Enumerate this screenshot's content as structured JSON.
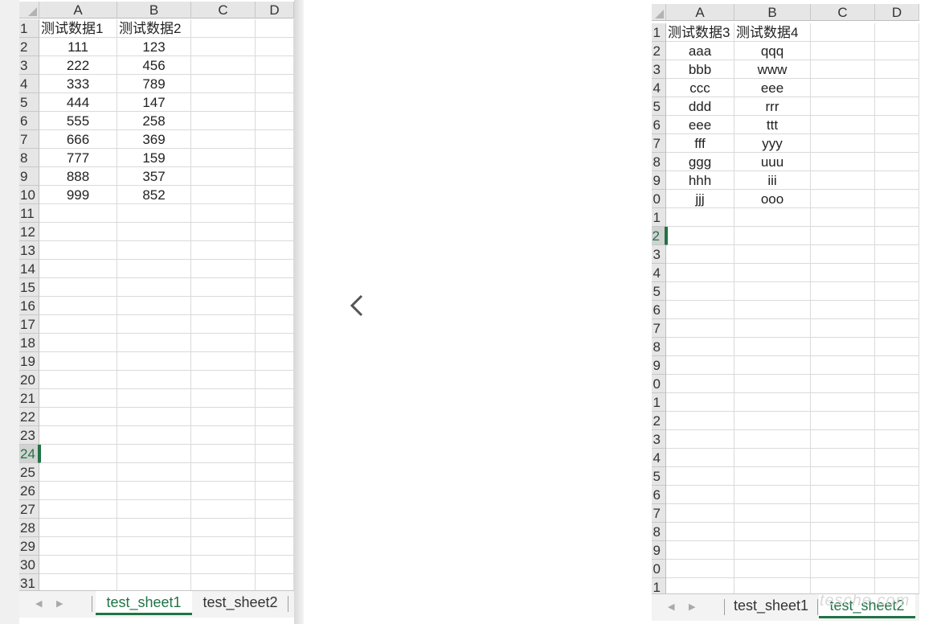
{
  "left": {
    "columns": [
      "A",
      "B",
      "C",
      "D"
    ],
    "row_numbers": [
      "1",
      "2",
      "3",
      "4",
      "5",
      "6",
      "7",
      "8",
      "9",
      "10",
      "11",
      "12",
      "13",
      "14",
      "15",
      "16",
      "17",
      "18",
      "19",
      "20",
      "21",
      "22",
      "23",
      "24",
      "25",
      "26",
      "27",
      "28",
      "29",
      "30",
      "31"
    ],
    "active_row": "24",
    "rows": [
      [
        "测试数据1",
        "测试数据2"
      ],
      [
        "111",
        "123"
      ],
      [
        "222",
        "456"
      ],
      [
        "333",
        "789"
      ],
      [
        "444",
        "147"
      ],
      [
        "555",
        "258"
      ],
      [
        "666",
        "369"
      ],
      [
        "777",
        "159"
      ],
      [
        "888",
        "357"
      ],
      [
        "999",
        "852"
      ]
    ],
    "tabs": [
      "test_sheet1",
      "test_sheet2"
    ],
    "active_tab": 0
  },
  "right": {
    "columns": [
      "A",
      "B",
      "C",
      "D"
    ],
    "row_numbers": [
      "1",
      "2",
      "3",
      "4",
      "5",
      "6",
      "7",
      "8",
      "9",
      "0",
      "1",
      "2",
      "3",
      "4",
      "5",
      "6",
      "7",
      "8",
      "9",
      "0",
      "1",
      "2",
      "3",
      "4",
      "5",
      "6",
      "7",
      "8",
      "9",
      "0",
      "1"
    ],
    "active_row_index": 11,
    "rows": [
      [
        "测试数据3",
        "测试数据4"
      ],
      [
        "aaa",
        "qqq"
      ],
      [
        "bbb",
        "www"
      ],
      [
        "ccc",
        "eee"
      ],
      [
        "ddd",
        "rrr"
      ],
      [
        "eee",
        "ttt"
      ],
      [
        "fff",
        "yyy"
      ],
      [
        "ggg",
        "uuu"
      ],
      [
        "hhh",
        "iii"
      ],
      [
        "jjj",
        "ooo"
      ]
    ],
    "tabs": [
      "test_sheet1",
      "test_sheet2"
    ],
    "active_tab": 1
  },
  "nav": {
    "icon": "chevron-left-icon"
  },
  "watermark": "tesche.com",
  "colors": {
    "accent": "#217346",
    "header_bg": "#e6e6e6",
    "topline": "#35a6e6"
  }
}
